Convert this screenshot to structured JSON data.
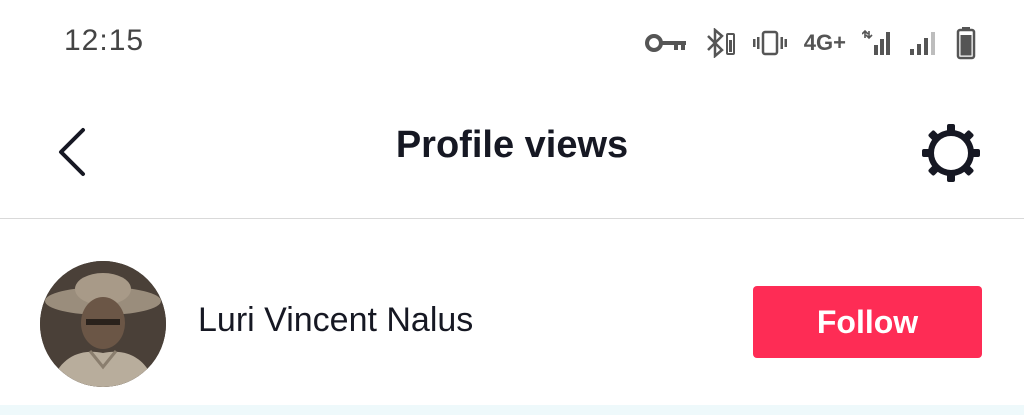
{
  "status_bar": {
    "time": "12:15",
    "network_label": "4G+",
    "icons": [
      "key-icon",
      "bluetooth-icon",
      "vibrate-icon",
      "network-label",
      "signal-icon",
      "signal-icon",
      "battery-icon"
    ]
  },
  "header": {
    "title": "Profile views",
    "back_icon": "chevron-left-icon",
    "settings_icon": "gear-icon"
  },
  "viewer": {
    "name": "Luri Vincent Nalus",
    "follow_label": "Follow",
    "avatar": "avatar"
  },
  "colors": {
    "accent": "#fe2c55",
    "text": "#161823",
    "divider": "#d9d9d9"
  }
}
